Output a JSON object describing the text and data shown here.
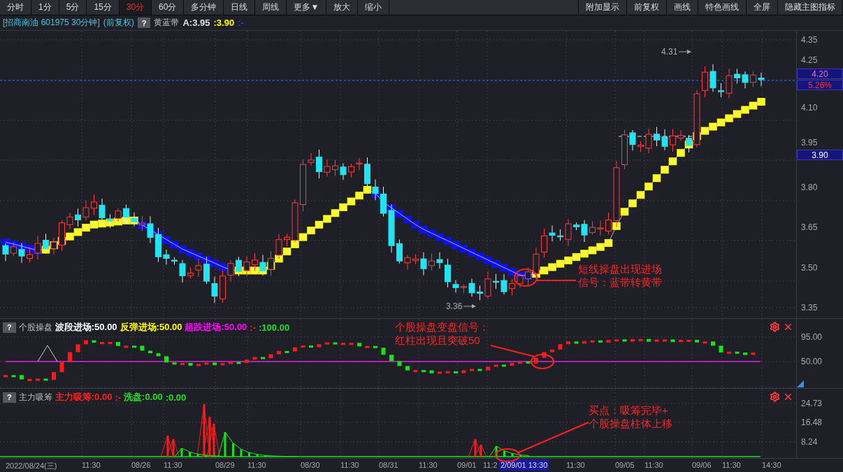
{
  "toolbar": {
    "left": [
      {
        "label": "分时",
        "selected": false
      },
      {
        "label": "1分",
        "selected": false
      },
      {
        "label": "5分",
        "selected": false
      },
      {
        "label": "15分",
        "selected": false
      },
      {
        "label": "30分",
        "selected": true
      },
      {
        "label": "60分",
        "selected": false
      },
      {
        "label": "多分钟",
        "selected": false
      },
      {
        "label": "日线",
        "selected": false
      },
      {
        "label": "周线",
        "selected": false
      },
      {
        "label": "更多▼",
        "selected": false
      },
      {
        "label": "放大",
        "selected": false
      },
      {
        "label": "缩小",
        "selected": false
      }
    ],
    "right": [
      {
        "label": "附加显示"
      },
      {
        "label": "前复权"
      },
      {
        "label": "画线"
      },
      {
        "label": "特色画线"
      },
      {
        "label": "全屏"
      },
      {
        "label": "隐藏主图指标"
      }
    ]
  },
  "main_chart": {
    "stock": "[招商南油 601975 30分钟]",
    "adjust": "(前复权)",
    "help": "?",
    "indicator": "黄蓝带",
    "values": [
      {
        "text": "A:3.95",
        "color": "#e0e0e0"
      },
      {
        "text": ":3.90",
        "color": "#ffff00"
      },
      {
        "text": ":-",
        "color": "#2040ff"
      }
    ],
    "price_axis": [
      "4.35",
      "4.25",
      "4.10",
      "3.95",
      "3.80",
      "3.65",
      "3.50",
      "3.35"
    ],
    "price_tags": [
      {
        "text": "4.20",
        "kind": "price"
      },
      {
        "text": "5.26%",
        "kind": "change"
      },
      {
        "text": "3.90",
        "kind": "indicator"
      }
    ],
    "extremes": [
      {
        "text": "4.31",
        "kind": "high"
      },
      {
        "text": "3.36",
        "kind": "low"
      }
    ],
    "annotation": "短线操盘出现进场信号：蓝带转黄带"
  },
  "panels": [
    {
      "help": "?",
      "name": "个股操盘",
      "values": [
        {
          "text": "波段进场:50.00",
          "color": "#ffffff"
        },
        {
          "text": "反弹进场:50.00",
          "color": "#ffff00"
        },
        {
          "text": "超跌进场:50.00",
          "color": "#ff00ff"
        },
        {
          "text": ":-",
          "color": "#ff2020"
        },
        {
          "text": ":100.00",
          "color": "#20e020"
        }
      ],
      "axis": [
        "95.00",
        "50.00"
      ],
      "annotation": "个股操盘变盘信号：红柱出现且突破50"
    },
    {
      "help": "?",
      "name": "主力吸筹",
      "values": [
        {
          "text": "主力吸筹:0.00",
          "color": "#ff2020"
        },
        {
          "text": ":-",
          "color": "#ff2020"
        },
        {
          "text": "洗盘:0.00",
          "color": "#20e020"
        },
        {
          "text": ":0.00",
          "color": "#20e020"
        }
      ],
      "axis": [
        "24.73",
        "16.48",
        "8.24"
      ],
      "annotation": "买点：吸筹完毕+个股操盘柱体上移"
    }
  ],
  "time_axis": {
    "labels": [
      "2022/08/24(三)",
      "11:30",
      "08/26",
      "11:30",
      "08/29",
      "11:30",
      "08/30",
      "11:30",
      "08/31",
      "11:30",
      "09/01",
      "11:2",
      "11:30",
      "09/05",
      "11:30",
      "09/06",
      "11:30",
      "14:30"
    ],
    "cursor": "2/09/01 13:30"
  }
}
